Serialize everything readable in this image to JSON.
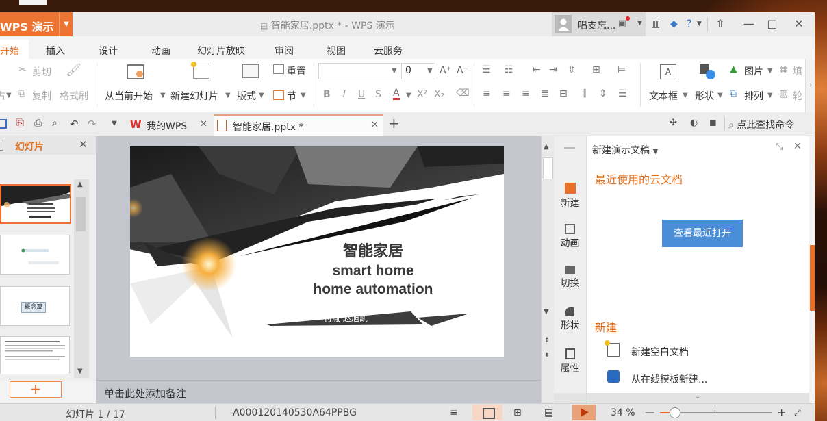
{
  "app": {
    "logo_label": "WPS 演示",
    "doc_title": "智能家居.pptx * - WPS 演示",
    "user_name": "唱支忘..."
  },
  "menu": {
    "tabs": [
      "开始",
      "插入",
      "设计",
      "动画",
      "幻灯片放映",
      "审阅",
      "视图",
      "云服务"
    ]
  },
  "ribbon": {
    "cut": "剪切",
    "copy": "复制",
    "format_painter": "格式刷",
    "paste_partial": "占",
    "from_current": "从当前开始",
    "new_slide": "新建幻灯片",
    "layout": "版式",
    "reset": "重置",
    "section": "节",
    "font_size": "0",
    "textbox": "文本框",
    "shape": "形状",
    "picture": "图片",
    "arrange": "排列",
    "fill_partial": "填",
    "outline_partial": "轮"
  },
  "quickbar": {
    "tab_mywps": "我的WPS",
    "tab_doc": "智能家居.pptx *",
    "search_cmd": "点此查找命令"
  },
  "left_panel": {
    "title": "幻灯片",
    "add_label": "+"
  },
  "slide": {
    "title_cn": "智能家居",
    "title_en1": "smart home",
    "title_en2": "home automation",
    "authors": "付胤 赵旭凯",
    "thumb2_label": "概念篇"
  },
  "notes_placeholder": "单击此处添加备注",
  "right_side": {
    "items": [
      "新建",
      "动画",
      "切换",
      "形状",
      "属性"
    ]
  },
  "task_pane": {
    "title": "新建演示文稿",
    "recent_cloud": "最近使用的云文档",
    "view_recent": "查看最近打开",
    "new_section": "新建",
    "new_blank": "新建空白文档",
    "from_template": "从在线模板新建..."
  },
  "status": {
    "slide_counter": "幻灯片 1 / 17",
    "theme_code": "A000120140530A64PPBG",
    "zoom": "34 %"
  },
  "colors": {
    "accent_orange": "#ec7433",
    "link_orange": "#e2701f",
    "button_blue": "#4a8ed8"
  }
}
